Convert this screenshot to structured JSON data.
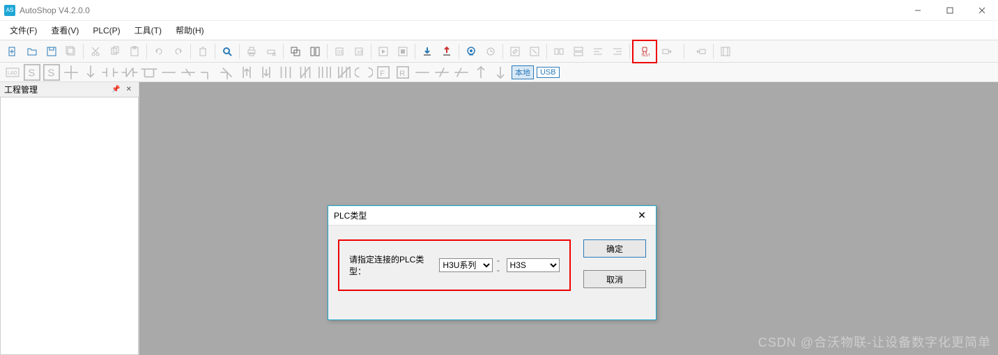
{
  "window": {
    "title": "AutoShop V4.2.0.0"
  },
  "menubar": {
    "file": "文件(F)",
    "view": "查看(V)",
    "plc": "PLC(P)",
    "tools": "工具(T)",
    "help": "帮助(H)"
  },
  "toolbar2": {
    "local": "本地",
    "usb": "USB"
  },
  "panel": {
    "title": "工程管理"
  },
  "dialog": {
    "title": "PLC类型",
    "label": "请指定连接的PLC类型：",
    "series_value": "H3U系列",
    "model_value": "H3S",
    "ok": "确定",
    "cancel": "取消"
  },
  "watermark": "CSDN @合沃物联-让设备数字化更简单"
}
